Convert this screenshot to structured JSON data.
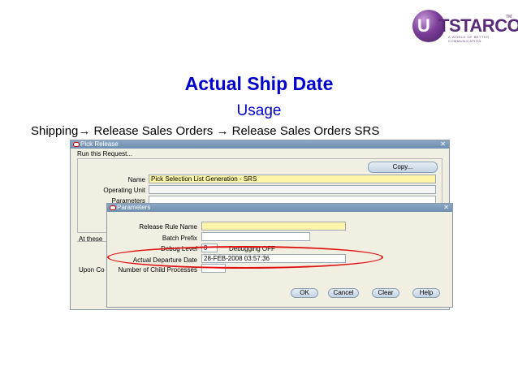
{
  "logo": {
    "mark": "U",
    "text": "TSTARCOM",
    "tagline": "A WORLD OF BETTER COMMUNICATION",
    "tm": "TM"
  },
  "slide": {
    "title": "Actual Ship Date",
    "subtitle": "Usage",
    "path": "Shipping→ Release Sales Orders → Release Sales Orders SRS"
  },
  "pick_release": {
    "title": "Pick Release",
    "run_request": "Run this Request...",
    "copy_button": "Copy...",
    "fields": {
      "name_label": "Name",
      "name_value": "Pick Selection List Generation - SRS",
      "operating_unit_label": "Operating Unit",
      "operating_unit_value": "",
      "parameters_label": "Parameters",
      "parameters_value": ""
    },
    "at_these": "At these",
    "upon_completion": "Upon Co",
    "cut_label": "I"
  },
  "parameters": {
    "title": "Parameters",
    "fields": {
      "release_rule_label": "Release Rule Name",
      "release_rule_value": "",
      "batch_prefix_label": "Batch Prefix",
      "batch_prefix_value": "",
      "debug_level_label": "Debug Level",
      "debug_level_value": "0",
      "debug_level_desc": "Debugging OFF",
      "actual_departure_label": "Actual Departure Date",
      "actual_departure_value": "28-FEB-2008 03:57:36",
      "child_processes_label": "Number of Child Processes",
      "child_processes_value": ""
    },
    "buttons": {
      "ok": "OK",
      "cancel": "Cancel",
      "clear": "Clear",
      "help": "Help"
    }
  },
  "colors": {
    "title_blue": "#0000cc",
    "highlight_red": "#e01010",
    "field_yellow": "#fff5a8"
  }
}
